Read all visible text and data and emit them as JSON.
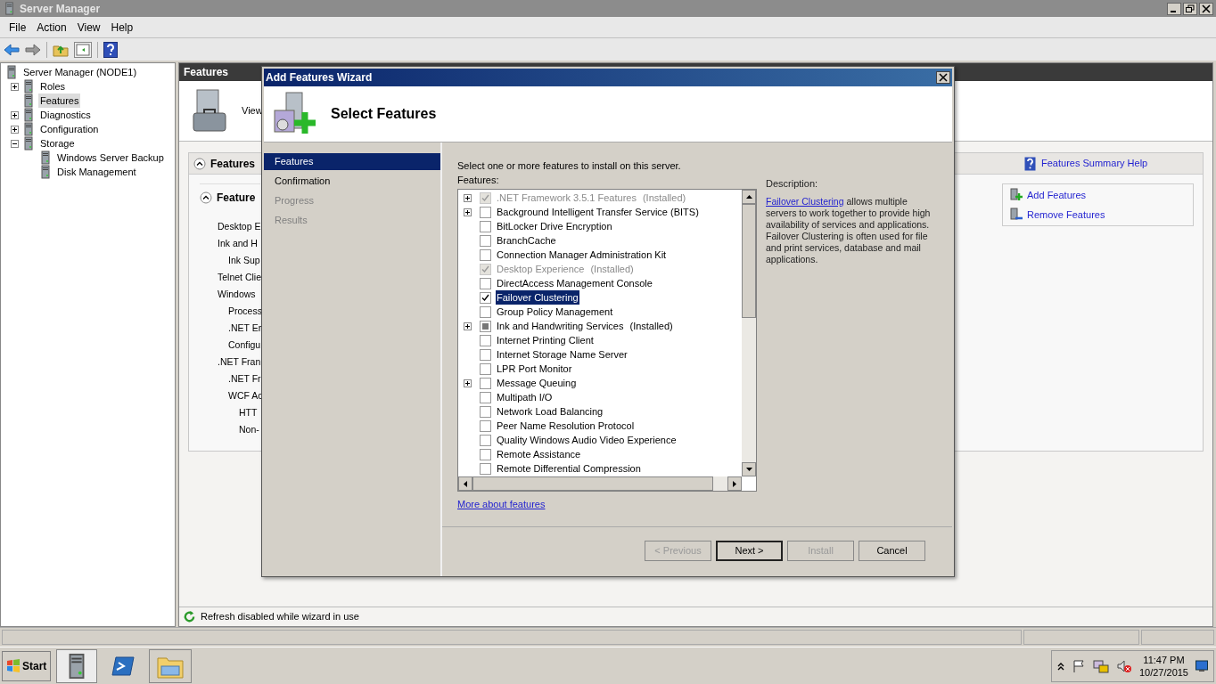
{
  "window": {
    "title": "Server Manager"
  },
  "menu": [
    "File",
    "Action",
    "View",
    "Help"
  ],
  "tree": [
    {
      "label": "Server Manager (NODE1)",
      "selected": false,
      "children": [
        {
          "label": "Roles",
          "expanded": false,
          "selected": false
        },
        {
          "label": "Features",
          "selected": true
        },
        {
          "label": "Diagnostics",
          "expanded": false,
          "selected": false
        },
        {
          "label": "Configuration",
          "expanded": false,
          "selected": false
        },
        {
          "label": "Storage",
          "expanded": true,
          "selected": false,
          "children": [
            {
              "label": "Windows Server Backup",
              "selected": false
            },
            {
              "label": "Disk Management",
              "selected": false
            }
          ]
        }
      ]
    }
  ],
  "content": {
    "header": "Features",
    "intro": "View",
    "section_title": "Features",
    "summary_help": "Features Summary Help",
    "subsection_title": "Feature",
    "installed": [
      {
        "label": "Desktop E"
      },
      {
        "label": "Ink and H",
        "children": [
          {
            "label": "Ink Sup"
          }
        ]
      },
      {
        "label": "Telnet Clie"
      },
      {
        "label": "Windows",
        "children": [
          {
            "label": "Process"
          },
          {
            "label": ".NET Er"
          },
          {
            "label": "Configu"
          }
        ]
      },
      {
        "label": ".NET Fran",
        "children": [
          {
            "label": ".NET Fr"
          },
          {
            "label": "WCF Ac",
            "children": [
              {
                "label": "HTT"
              },
              {
                "label": "Non-"
              }
            ]
          }
        ]
      }
    ],
    "actions": [
      {
        "label": "Add Features",
        "kind": "add"
      },
      {
        "label": "Remove Features",
        "kind": "remove"
      }
    ],
    "status": "Refresh disabled while wizard in use"
  },
  "wizard": {
    "title": "Add Features Wizard",
    "heading": "Select Features",
    "steps": [
      {
        "label": "Features",
        "selected": true,
        "disabled": false
      },
      {
        "label": "Confirmation",
        "selected": false,
        "disabled": false
      },
      {
        "label": "Progress",
        "selected": false,
        "disabled": true
      },
      {
        "label": "Results",
        "selected": false,
        "disabled": true
      }
    ],
    "instruction": "Select one or more features to install on this server.",
    "list_label": "Features:",
    "features": [
      {
        "label": ".NET Framework 3.5.1 Features",
        "note": "(Installed)",
        "checked": true,
        "indeterminate": false,
        "disabled": true,
        "expandable": true,
        "selected": false
      },
      {
        "label": "Background Intelligent Transfer Service (BITS)",
        "checked": false,
        "indeterminate": false,
        "disabled": false,
        "expandable": true,
        "selected": false
      },
      {
        "label": "BitLocker Drive Encryption",
        "checked": false,
        "indeterminate": false,
        "disabled": false,
        "expandable": false,
        "selected": false
      },
      {
        "label": "BranchCache",
        "checked": false,
        "indeterminate": false,
        "disabled": false,
        "expandable": false,
        "selected": false
      },
      {
        "label": "Connection Manager Administration Kit",
        "checked": false,
        "indeterminate": false,
        "disabled": false,
        "expandable": false,
        "selected": false
      },
      {
        "label": "Desktop Experience",
        "note": "(Installed)",
        "checked": true,
        "indeterminate": false,
        "disabled": true,
        "expandable": false,
        "selected": false
      },
      {
        "label": "DirectAccess Management Console",
        "checked": false,
        "indeterminate": false,
        "disabled": false,
        "expandable": false,
        "selected": false
      },
      {
        "label": "Failover Clustering",
        "checked": true,
        "indeterminate": false,
        "disabled": false,
        "expandable": false,
        "selected": true
      },
      {
        "label": "Group Policy Management",
        "checked": false,
        "indeterminate": false,
        "disabled": false,
        "expandable": false,
        "selected": false
      },
      {
        "label": "Ink and Handwriting Services",
        "note": "(Installed)",
        "checked": false,
        "indeterminate": true,
        "disabled": false,
        "expandable": true,
        "selected": false
      },
      {
        "label": "Internet Printing Client",
        "checked": false,
        "indeterminate": false,
        "disabled": false,
        "expandable": false,
        "selected": false
      },
      {
        "label": "Internet Storage Name Server",
        "checked": false,
        "indeterminate": false,
        "disabled": false,
        "expandable": false,
        "selected": false
      },
      {
        "label": "LPR Port Monitor",
        "checked": false,
        "indeterminate": false,
        "disabled": false,
        "expandable": false,
        "selected": false
      },
      {
        "label": "Message Queuing",
        "checked": false,
        "indeterminate": false,
        "disabled": false,
        "expandable": true,
        "selected": false
      },
      {
        "label": "Multipath I/O",
        "checked": false,
        "indeterminate": false,
        "disabled": false,
        "expandable": false,
        "selected": false
      },
      {
        "label": "Network Load Balancing",
        "checked": false,
        "indeterminate": false,
        "disabled": false,
        "expandable": false,
        "selected": false
      },
      {
        "label": "Peer Name Resolution Protocol",
        "checked": false,
        "indeterminate": false,
        "disabled": false,
        "expandable": false,
        "selected": false
      },
      {
        "label": "Quality Windows Audio Video Experience",
        "checked": false,
        "indeterminate": false,
        "disabled": false,
        "expandable": false,
        "selected": false
      },
      {
        "label": "Remote Assistance",
        "checked": false,
        "indeterminate": false,
        "disabled": false,
        "expandable": false,
        "selected": false
      },
      {
        "label": "Remote Differential Compression",
        "checked": false,
        "indeterminate": false,
        "disabled": false,
        "expandable": false,
        "selected": false
      }
    ],
    "description_label": "Description:",
    "description_link": "Failover Clustering",
    "description_text": "allows multiple servers to work together to provide high availability of services and applications. Failover Clustering is often used for file and print services, database and mail applications.",
    "more_link": "More about features",
    "buttons": [
      {
        "label": "< Previous",
        "disabled": true,
        "default": false
      },
      {
        "label": "Next >",
        "disabled": false,
        "default": true
      },
      {
        "label": "Install",
        "disabled": true,
        "default": false
      },
      {
        "label": "Cancel",
        "disabled": false,
        "default": false
      }
    ]
  },
  "taskbar": {
    "start": "Start",
    "time": "11:47 PM",
    "date": "10/27/2015"
  }
}
